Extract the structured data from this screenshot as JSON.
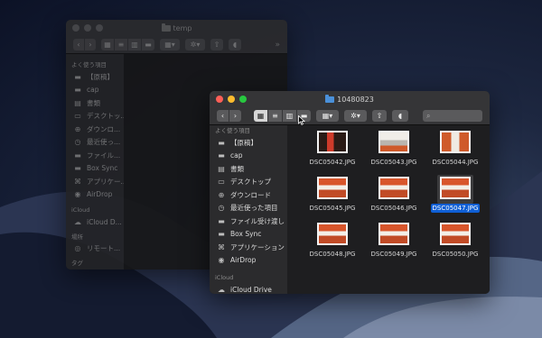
{
  "background_window": {
    "title": "temp",
    "view_modes": [
      "icon-view-icon",
      "list-view-icon",
      "column-view-icon",
      "gallery-view-icon"
    ],
    "sidebar": {
      "favorites_header": "よく使う項目",
      "favorites": [
        {
          "label": "【原稿】",
          "icon": "folder-icon"
        },
        {
          "label": "cap",
          "icon": "folder-icon"
        },
        {
          "label": "書類",
          "icon": "document-icon"
        },
        {
          "label": "デスクトッ...",
          "icon": "desktop-icon"
        },
        {
          "label": "ダウンロ...",
          "icon": "download-icon"
        },
        {
          "label": "最近使っ...",
          "icon": "recents-icon"
        },
        {
          "label": "ファイル...",
          "icon": "folder-icon"
        },
        {
          "label": "Box Sync",
          "icon": "folder-icon"
        },
        {
          "label": "アプリケー...",
          "icon": "applications-icon"
        },
        {
          "label": "AirDrop",
          "icon": "airdrop-icon"
        }
      ],
      "icloud_header": "iCloud",
      "icloud": [
        {
          "label": "iCloud D...",
          "icon": "cloud-icon"
        }
      ],
      "locations_header": "場所",
      "locations": [
        {
          "label": "リモート...",
          "icon": "disc-icon"
        }
      ],
      "tags_header": "タグ"
    }
  },
  "main_window": {
    "title": "10480823",
    "sidebar": {
      "favorites_header": "よく使う項目",
      "favorites": [
        {
          "label": "【原稿】",
          "icon": "folder-icon"
        },
        {
          "label": "cap",
          "icon": "folder-icon"
        },
        {
          "label": "書類",
          "icon": "document-icon"
        },
        {
          "label": "デスクトップ",
          "icon": "desktop-icon"
        },
        {
          "label": "ダウンロード",
          "icon": "download-icon"
        },
        {
          "label": "最近使った項目",
          "icon": "recents-icon"
        },
        {
          "label": "ファイル受け渡し",
          "icon": "folder-icon"
        },
        {
          "label": "Box Sync",
          "icon": "folder-icon"
        },
        {
          "label": "アプリケーション",
          "icon": "applications-icon"
        },
        {
          "label": "AirDrop",
          "icon": "airdrop-icon"
        }
      ],
      "icloud_header": "iCloud",
      "icloud": [
        {
          "label": "iCloud Drive",
          "icon": "cloud-icon"
        }
      ]
    },
    "files": [
      {
        "name": "DSC05042.JPG",
        "selected": false
      },
      {
        "name": "DSC05043.JPG",
        "selected": false
      },
      {
        "name": "DSC05044.JPG",
        "selected": false
      },
      {
        "name": "DSC05045.JPG",
        "selected": false
      },
      {
        "name": "DSC05046.JPG",
        "selected": false
      },
      {
        "name": "DSC05047.JPG",
        "selected": true
      },
      {
        "name": "DSC05048.JPG",
        "selected": false
      },
      {
        "name": "DSC05049.JPG",
        "selected": false
      },
      {
        "name": "DSC05050.JPG",
        "selected": false
      }
    ]
  },
  "colors": {
    "close": "#fe5f57",
    "minimize": "#febc2e",
    "zoom": "#28c840",
    "selection": "#0f5fd5",
    "folder_accent": "#4a90d9",
    "photo_orange": "#cf5a2a"
  }
}
